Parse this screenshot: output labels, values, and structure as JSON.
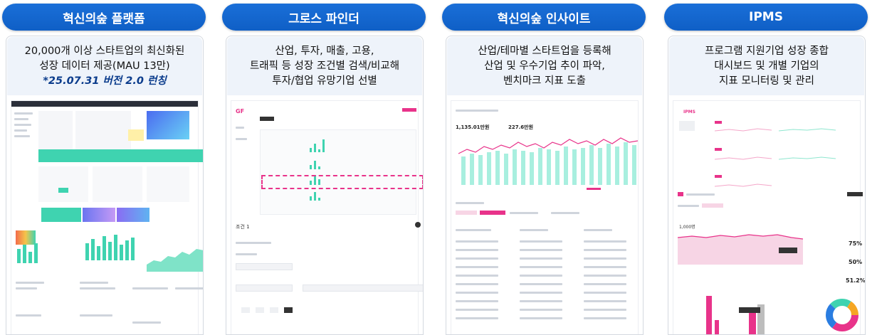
{
  "columns": [
    {
      "id": "platform",
      "title": "혁신의숲 플랫폼",
      "lines": [
        "20,000개 이상 스타트업의 최신화된",
        "성장 데이터 제공(MAU 13만)"
      ],
      "highlight": "*25.07.31 버전 2.0 런칭"
    },
    {
      "id": "growth-finder",
      "title": "그로스 파인더",
      "lines": [
        "산업, 투자, 매출, 고용,",
        "트래픽 등 성장 조건별 검색/비교해",
        "투자/협업 유망기업 선별"
      ]
    },
    {
      "id": "insight",
      "title": "혁신의숲 인사이트",
      "lines": [
        "산업/테마별 스타트업을 등록해",
        "산업 및 우수기업 추이 파악,",
        "벤치마크 지표 도출"
      ],
      "stat_values": [
        "1,135.01만원",
        "227.6만원"
      ]
    },
    {
      "id": "ipms",
      "title": "IPMS",
      "lines": [
        "프로그램 지원기업 성장 종합",
        "대시보드 및 개별 기업의",
        "지표 모니터링 및 관리"
      ],
      "brand": "IPMS",
      "kpis": [
        "75%",
        "50%",
        "51.2%"
      ],
      "value_label": "1,000명"
    }
  ],
  "gf_logo": "GF",
  "gf_condition_label": "조건 1",
  "colors": {
    "pill": "#1a6fd8",
    "mint": "#3fd3b0",
    "pink": "#e8338a",
    "desc_bg": "#eef3fa"
  }
}
